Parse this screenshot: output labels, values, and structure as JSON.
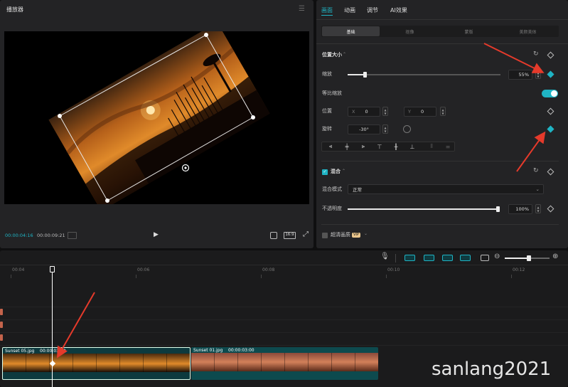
{
  "player": {
    "title": "播放器",
    "current_time": "00:00:04:16",
    "total_time": "00:00:09:21",
    "ratio": "16:9"
  },
  "tabs": [
    "画面",
    "动画",
    "调节",
    "AI效果"
  ],
  "subtabs": [
    "基础",
    "抠像",
    "蒙版",
    "美颜美体"
  ],
  "position_size": {
    "section": "位置大小",
    "scale_label": "缩放",
    "scale_value": "55%",
    "scale_fraction": 0.55,
    "uniform_label": "等比缩放",
    "position_label": "位置",
    "x_label": "X",
    "x_value": "0",
    "y_label": "Y",
    "y_value": "0",
    "rotate_label": "旋转",
    "rotate_value": "-30°"
  },
  "blend": {
    "section": "混合",
    "mode_label": "混合模式",
    "mode_value": "正常",
    "opacity_label": "不透明度",
    "opacity_value": "100%",
    "opacity_fraction": 1.0
  },
  "super_hd": {
    "label": "超清画质",
    "badge": "VIP"
  },
  "ruler": [
    "00:04",
    "00:06",
    "00:08",
    "00:10",
    "00:12"
  ],
  "clips": [
    {
      "name": "Sunset 05.jpg",
      "duration": "00:00:03:00"
    },
    {
      "name": "Sunset 01.jpg",
      "duration": "00:00:03:00"
    }
  ],
  "watermark": "sanlang2021",
  "colors": {
    "accent": "#1fb4c4",
    "arrow": "#e53a2b"
  }
}
